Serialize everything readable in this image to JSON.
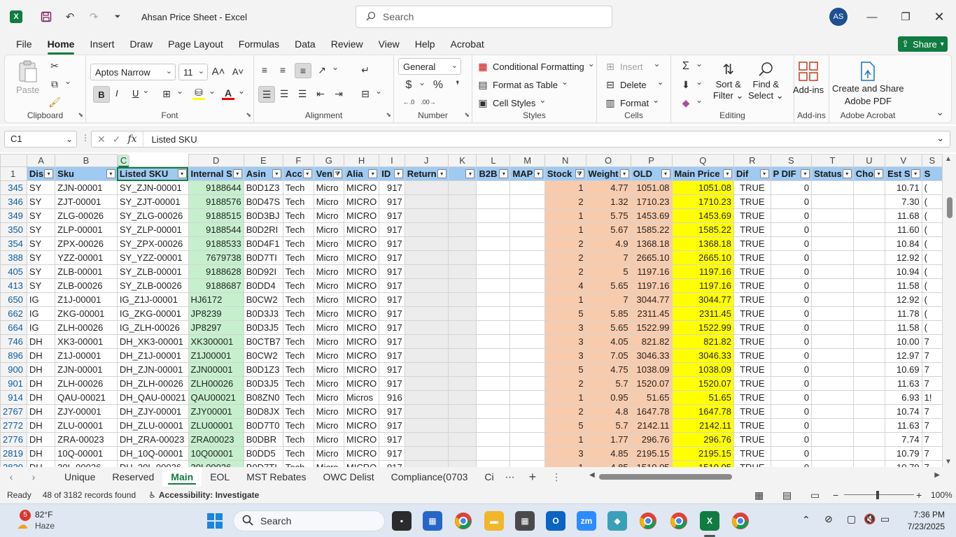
{
  "window": {
    "title": "Ahsan Price Sheet  -  Excel",
    "search_placeholder": "Search",
    "user_initials": "AS"
  },
  "menu": [
    "File",
    "Home",
    "Insert",
    "Draw",
    "Page Layout",
    "Formulas",
    "Data",
    "Review",
    "View",
    "Help",
    "Acrobat"
  ],
  "share_label": "Share",
  "ribbon": {
    "clipboard": {
      "paste": "Paste",
      "label": "Clipboard"
    },
    "font": {
      "name": "Aptos Narrow",
      "size": "11",
      "label": "Font"
    },
    "alignment": {
      "label": "Alignment"
    },
    "number": {
      "format": "General",
      "label": "Number"
    },
    "styles": {
      "conditional": "Conditional Formatting",
      "table": "Format as Table",
      "cell_styles": "Cell Styles",
      "label": "Styles"
    },
    "cells": {
      "insert": "Insert",
      "delete": "Delete",
      "format": "Format",
      "label": "Cells"
    },
    "editing": {
      "sort1": "Sort &",
      "sort2": "Filter",
      "find1": "Find &",
      "find2": "Select",
      "label": "Editing"
    },
    "addins": {
      "btn": "Add-ins",
      "label": "Add-ins"
    },
    "acrobat": {
      "btn1": "Create and Share",
      "btn2": "Adobe PDF",
      "label": "Adobe Acrobat"
    }
  },
  "formula_bar": {
    "name_box": "C1",
    "content": "Listed SKU"
  },
  "columns": [
    "A",
    "B",
    "C",
    "D",
    "E",
    "F",
    "G",
    "H",
    "I",
    "J",
    "K",
    "L",
    "M",
    "N",
    "O",
    "P",
    "Q",
    "R",
    "S",
    "T",
    "U",
    "V",
    "S"
  ],
  "header_row_number": "1",
  "headers": [
    "Dis",
    "Sku",
    "Listed SKU",
    "Internal S",
    "Asin",
    "Acc",
    "Ven",
    "Alia",
    "ID",
    "Return",
    "",
    "B2B",
    "MAP",
    "Stock",
    "Weight",
    "OLD",
    "Main Price",
    "Dif",
    "P DIF",
    "Status",
    "Cho",
    "Est S",
    "S"
  ],
  "rows": [
    {
      "n": "345",
      "c": [
        "SY",
        "ZJN-00001",
        "SY_ZJN-00001",
        "9188644",
        "B0D1Z3",
        "Tech",
        "Micro",
        "MICRO",
        "917",
        "",
        "",
        "",
        "",
        "1",
        "4.77",
        "1051.08",
        "1051.08",
        "TRUE",
        "0",
        "",
        "",
        "10.71",
        "("
      ]
    },
    {
      "n": "346",
      "c": [
        "SY",
        "ZJT-00001",
        "SY_ZJT-00001",
        "9188576",
        "B0D47S",
        "Tech",
        "Micro",
        "MICRO",
        "917",
        "",
        "",
        "",
        "",
        "2",
        "1.32",
        "1710.23",
        "1710.23",
        "TRUE",
        "0",
        "",
        "",
        "7.30",
        "("
      ]
    },
    {
      "n": "349",
      "c": [
        "SY",
        "ZLG-00026",
        "SY_ZLG-00026",
        "9188515",
        "B0D3BJ",
        "Tech",
        "Micro",
        "MICRO",
        "917",
        "",
        "",
        "",
        "",
        "1",
        "5.75",
        "1453.69",
        "1453.69",
        "TRUE",
        "0",
        "",
        "",
        "11.68",
        "("
      ]
    },
    {
      "n": "350",
      "c": [
        "SY",
        "ZLP-00001",
        "SY_ZLP-00001",
        "9188544",
        "B0D2RI",
        "Tech",
        "Micro",
        "MICRO",
        "917",
        "",
        "",
        "",
        "",
        "1",
        "5.67",
        "1585.22",
        "1585.22",
        "TRUE",
        "0",
        "",
        "",
        "11.60",
        "("
      ]
    },
    {
      "n": "354",
      "c": [
        "SY",
        "ZPX-00026",
        "SY_ZPX-00026",
        "9188533",
        "B0D4F1",
        "Tech",
        "Micro",
        "MICRO",
        "917",
        "",
        "",
        "",
        "",
        "2",
        "4.9",
        "1368.18",
        "1368.18",
        "TRUE",
        "0",
        "",
        "",
        "10.84",
        "("
      ]
    },
    {
      "n": "388",
      "c": [
        "SY",
        "YZZ-00001",
        "SY_YZZ-00001",
        "7679738",
        "B0D7TI",
        "Tech",
        "Micro",
        "MICRO",
        "917",
        "",
        "",
        "",
        "",
        "2",
        "7",
        "2665.10",
        "2665.10",
        "TRUE",
        "0",
        "",
        "",
        "12.92",
        "("
      ]
    },
    {
      "n": "405",
      "c": [
        "SY",
        "ZLB-00001",
        "SY_ZLB-00001",
        "9188628",
        "B0D92I",
        "Tech",
        "Micro",
        "MICRO",
        "917",
        "",
        "",
        "",
        "",
        "2",
        "5",
        "1197.16",
        "1197.16",
        "TRUE",
        "0",
        "",
        "",
        "10.94",
        "("
      ]
    },
    {
      "n": "413",
      "c": [
        "SY",
        "ZLB-00026",
        "SY_ZLB-00026",
        "9188687",
        "B0DD4",
        "Tech",
        "Micro",
        "MICRO",
        "917",
        "",
        "",
        "",
        "",
        "4",
        "5.65",
        "1197.16",
        "1197.16",
        "TRUE",
        "0",
        "",
        "",
        "11.58",
        "("
      ]
    },
    {
      "n": "650",
      "c": [
        "IG",
        "Z1J-00001",
        "IG_Z1J-00001",
        "HJ6172",
        "B0CW2",
        "Tech",
        "Micro",
        "MICRO",
        "917",
        "",
        "",
        "",
        "",
        "1",
        "7",
        "3044.77",
        "3044.77",
        "TRUE",
        "0",
        "",
        "",
        "12.92",
        "("
      ]
    },
    {
      "n": "662",
      "c": [
        "IG",
        "ZKG-00001",
        "IG_ZKG-00001",
        "JP8239",
        "B0D3J3",
        "Tech",
        "Micro",
        "MICRO",
        "917",
        "",
        "",
        "",
        "",
        "5",
        "5.85",
        "2311.45",
        "2311.45",
        "TRUE",
        "0",
        "",
        "",
        "11.78",
        "("
      ]
    },
    {
      "n": "664",
      "c": [
        "IG",
        "ZLH-00026",
        "IG_ZLH-00026",
        "JP8297",
        "B0D3J5",
        "Tech",
        "Micro",
        "MICRO",
        "917",
        "",
        "",
        "",
        "",
        "3",
        "5.65",
        "1522.99",
        "1522.99",
        "TRUE",
        "0",
        "",
        "",
        "11.58",
        "("
      ]
    },
    {
      "n": "746",
      "c": [
        "DH",
        "XK3-00001",
        "DH_XK3-00001",
        "XK300001",
        "B0CTB7",
        "Tech",
        "Micro",
        "MICRO",
        "917",
        "",
        "",
        "",
        "",
        "3",
        "4.05",
        "821.82",
        "821.82",
        "TRUE",
        "0",
        "",
        "",
        "10.00",
        "7"
      ]
    },
    {
      "n": "896",
      "c": [
        "DH",
        "Z1J-00001",
        "DH_Z1J-00001",
        "Z1J00001",
        "B0CW2",
        "Tech",
        "Micro",
        "MICRO",
        "917",
        "",
        "",
        "",
        "",
        "3",
        "7.05",
        "3046.33",
        "3046.33",
        "TRUE",
        "0",
        "",
        "",
        "12.97",
        "7"
      ]
    },
    {
      "n": "900",
      "c": [
        "DH",
        "ZJN-00001",
        "DH_ZJN-00001",
        "ZJN00001",
        "B0D1Z3",
        "Tech",
        "Micro",
        "MICRO",
        "917",
        "",
        "",
        "",
        "",
        "5",
        "4.75",
        "1038.09",
        "1038.09",
        "TRUE",
        "0",
        "",
        "",
        "10.69",
        "7"
      ]
    },
    {
      "n": "901",
      "c": [
        "DH",
        "ZLH-00026",
        "DH_ZLH-00026",
        "ZLH00026",
        "B0D3J5",
        "Tech",
        "Micro",
        "MICRO",
        "917",
        "",
        "",
        "",
        "",
        "2",
        "5.7",
        "1520.07",
        "1520.07",
        "TRUE",
        "0",
        "",
        "",
        "11.63",
        "7"
      ]
    },
    {
      "n": "914",
      "c": [
        "DH",
        "QAU-00021",
        "DH_QAU-00021",
        "QAU00021",
        "B08ZN0",
        "Tech",
        "Micro",
        "Micros",
        "916",
        "",
        "",
        "",
        "",
        "1",
        "0.95",
        "51.65",
        "51.65",
        "TRUE",
        "0",
        "",
        "",
        "6.93",
        "1!"
      ]
    },
    {
      "n": "2767",
      "c": [
        "DH",
        "ZJY-00001",
        "DH_ZJY-00001",
        "ZJY00001",
        "B0D8JX",
        "Tech",
        "Micro",
        "MICRO",
        "917",
        "",
        "",
        "",
        "",
        "2",
        "4.8",
        "1647.78",
        "1647.78",
        "TRUE",
        "0",
        "",
        "",
        "10.74",
        "7"
      ]
    },
    {
      "n": "2772",
      "c": [
        "DH",
        "ZLU-00001",
        "DH_ZLU-00001",
        "ZLU00001",
        "B0D7T0",
        "Tech",
        "Micro",
        "MICRO",
        "917",
        "",
        "",
        "",
        "",
        "5",
        "5.7",
        "2142.11",
        "2142.11",
        "TRUE",
        "0",
        "",
        "",
        "11.63",
        "7"
      ]
    },
    {
      "n": "2776",
      "c": [
        "DH",
        "ZRA-00023",
        "DH_ZRA-00023",
        "ZRA00023",
        "B0DBR",
        "Tech",
        "Micro",
        "MICRO",
        "917",
        "",
        "",
        "",
        "",
        "1",
        "1.77",
        "296.76",
        "296.76",
        "TRUE",
        "0",
        "",
        "",
        "7.74",
        "7"
      ]
    },
    {
      "n": "2819",
      "c": [
        "DH",
        "10Q-00001",
        "DH_10Q-00001",
        "10Q00001",
        "B0DD5",
        "Tech",
        "Micro",
        "MICRO",
        "917",
        "",
        "",
        "",
        "",
        "3",
        "4.85",
        "2195.15",
        "2195.15",
        "TRUE",
        "0",
        "",
        "",
        "10.79",
        "7"
      ]
    },
    {
      "n": "2820",
      "c": [
        "DH",
        "30L-00026",
        "DH_30L-00026",
        "30L00026",
        "B0D7TI",
        "Tech",
        "Micro",
        "MICRO",
        "917",
        "",
        "",
        "",
        "",
        "1",
        "4.85",
        "1510.05",
        "1510.05",
        "TRUE",
        "0",
        "",
        "",
        "10.79",
        "7"
      ]
    }
  ],
  "sheet_tabs": [
    "Unique",
    "Reserved",
    "Main",
    "EOL",
    "MST Rebates",
    "OWC Delist",
    "Compliance(0703",
    "Ci"
  ],
  "active_tab": "Main",
  "status": {
    "ready": "Ready",
    "records": "48 of 3182 records found",
    "accessibility": "Accessibility: Investigate",
    "zoom": "100%"
  },
  "taskbar": {
    "weather_temp": "82°F",
    "weather_desc": "Haze",
    "weather_badge": "5",
    "search": "Search",
    "time": "7:36 PM",
    "date": "7/23/2025"
  },
  "colors": {
    "accent": "#107c41",
    "header_blue": "#9fcaf2",
    "green": "#c6efce",
    "salmon": "#f8cbad",
    "yellow": "#ffff00"
  }
}
